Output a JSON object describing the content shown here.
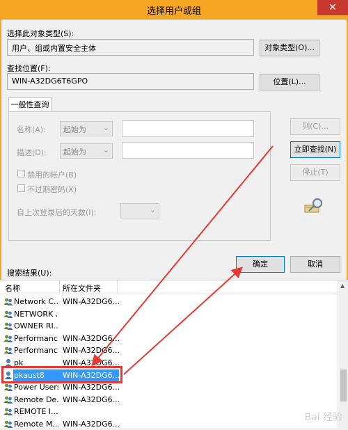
{
  "window": {
    "title": "选择用户或组",
    "close_glyph": "✕"
  },
  "object_type": {
    "label": "选择此对象类型(S):",
    "value": "用户、组或内置安全主体",
    "button": "对象类型(O)..."
  },
  "location": {
    "label": "查找位置(F):",
    "value": "WIN-A32DG6T6GPO",
    "button": "位置(L)..."
  },
  "query": {
    "tab": "一般性查询",
    "name_label": "名称(A):",
    "name_mode": "起始为",
    "desc_label": "描述(D):",
    "desc_mode": "起始为",
    "disabled_accounts": "禁用的帐户(B)",
    "non_expiring": "不过期密码(X)",
    "days_label": "自上次登录后的天数(I):"
  },
  "side_buttons": {
    "columns": "列(C)...",
    "find_now": "立即查找(N)",
    "stop": "停止(T)"
  },
  "actions": {
    "ok": "确定",
    "cancel": "取消"
  },
  "results": {
    "label": "搜索结果(U):",
    "col_name": "名称",
    "col_folder": "所在文件夹",
    "rows": [
      {
        "name": "Network C...",
        "folder": "WIN-A32DG6...",
        "icon": "group-icon"
      },
      {
        "name": "NETWORK ...",
        "folder": "",
        "icon": "group-icon"
      },
      {
        "name": "OWNER RI...",
        "folder": "",
        "icon": "group-icon"
      },
      {
        "name": "Performanc...",
        "folder": "WIN-A32DG6...",
        "icon": "group-icon"
      },
      {
        "name": "Performanc...",
        "folder": "WIN-A32DG6...",
        "icon": "group-icon"
      },
      {
        "name": "pk",
        "folder": "WIN-A32DG6...",
        "icon": "user-icon"
      },
      {
        "name": "pkaust8",
        "folder": "WIN-A32DG6...",
        "icon": "user-icon",
        "selected": true
      },
      {
        "name": "Power Users",
        "folder": "WIN-A32DG6...",
        "icon": "group-icon"
      },
      {
        "name": "Remote De...",
        "folder": "WIN-A32DG6...",
        "icon": "group-icon"
      },
      {
        "name": "REMOTE I...",
        "folder": "",
        "icon": "group-icon"
      },
      {
        "name": "Remote M...",
        "folder": "WIN-A32DG6...",
        "icon": "group-icon"
      }
    ]
  },
  "colors": {
    "titlebar": "#f5a623",
    "selection": "#3399ff",
    "annotation": "#e53935"
  },
  "watermark": "Bai 经验"
}
